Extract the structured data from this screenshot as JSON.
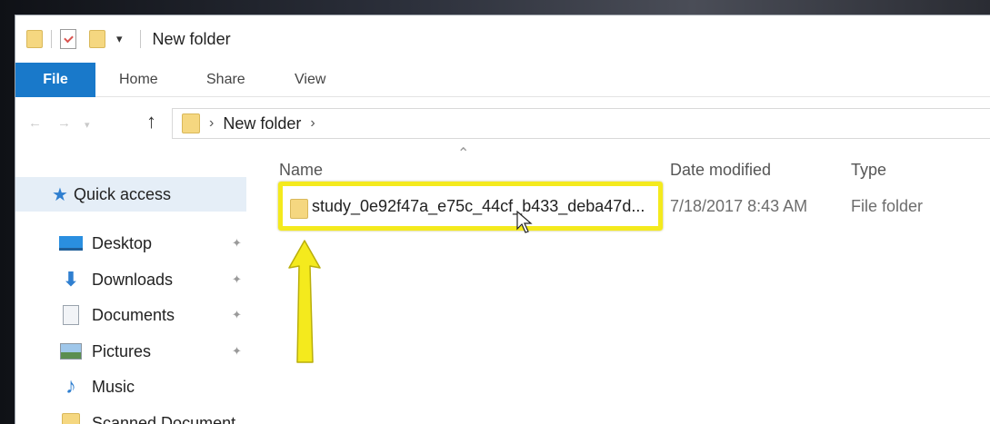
{
  "window": {
    "title": "New folder"
  },
  "ribbon": {
    "tabs": [
      "File",
      "Home",
      "Share",
      "View"
    ]
  },
  "address": {
    "crumbs": [
      "New folder"
    ]
  },
  "nav": {
    "quick_access": "Quick access",
    "items": [
      {
        "label": "Desktop",
        "icon": "desktop-icon",
        "pinned": true
      },
      {
        "label": "Downloads",
        "icon": "downloads-icon",
        "pinned": true
      },
      {
        "label": "Documents",
        "icon": "documents-icon",
        "pinned": true
      },
      {
        "label": "Pictures",
        "icon": "pictures-icon",
        "pinned": true
      },
      {
        "label": "Music",
        "icon": "music-icon",
        "pinned": false
      },
      {
        "label": "Scanned Document",
        "icon": "folder-icon",
        "pinned": false
      }
    ]
  },
  "columns": {
    "name": "Name",
    "date": "Date modified",
    "type": "Type"
  },
  "files": [
    {
      "name": "study_0e92f47a_e75c_44cf_b433_deba47d...",
      "date": "7/18/2017 8:43 AM",
      "type": "File folder"
    }
  ],
  "colors": {
    "accent": "#1979ca",
    "highlight": "#f4ea1d",
    "folder": "#f5d780",
    "selection": "#e5eef7"
  }
}
